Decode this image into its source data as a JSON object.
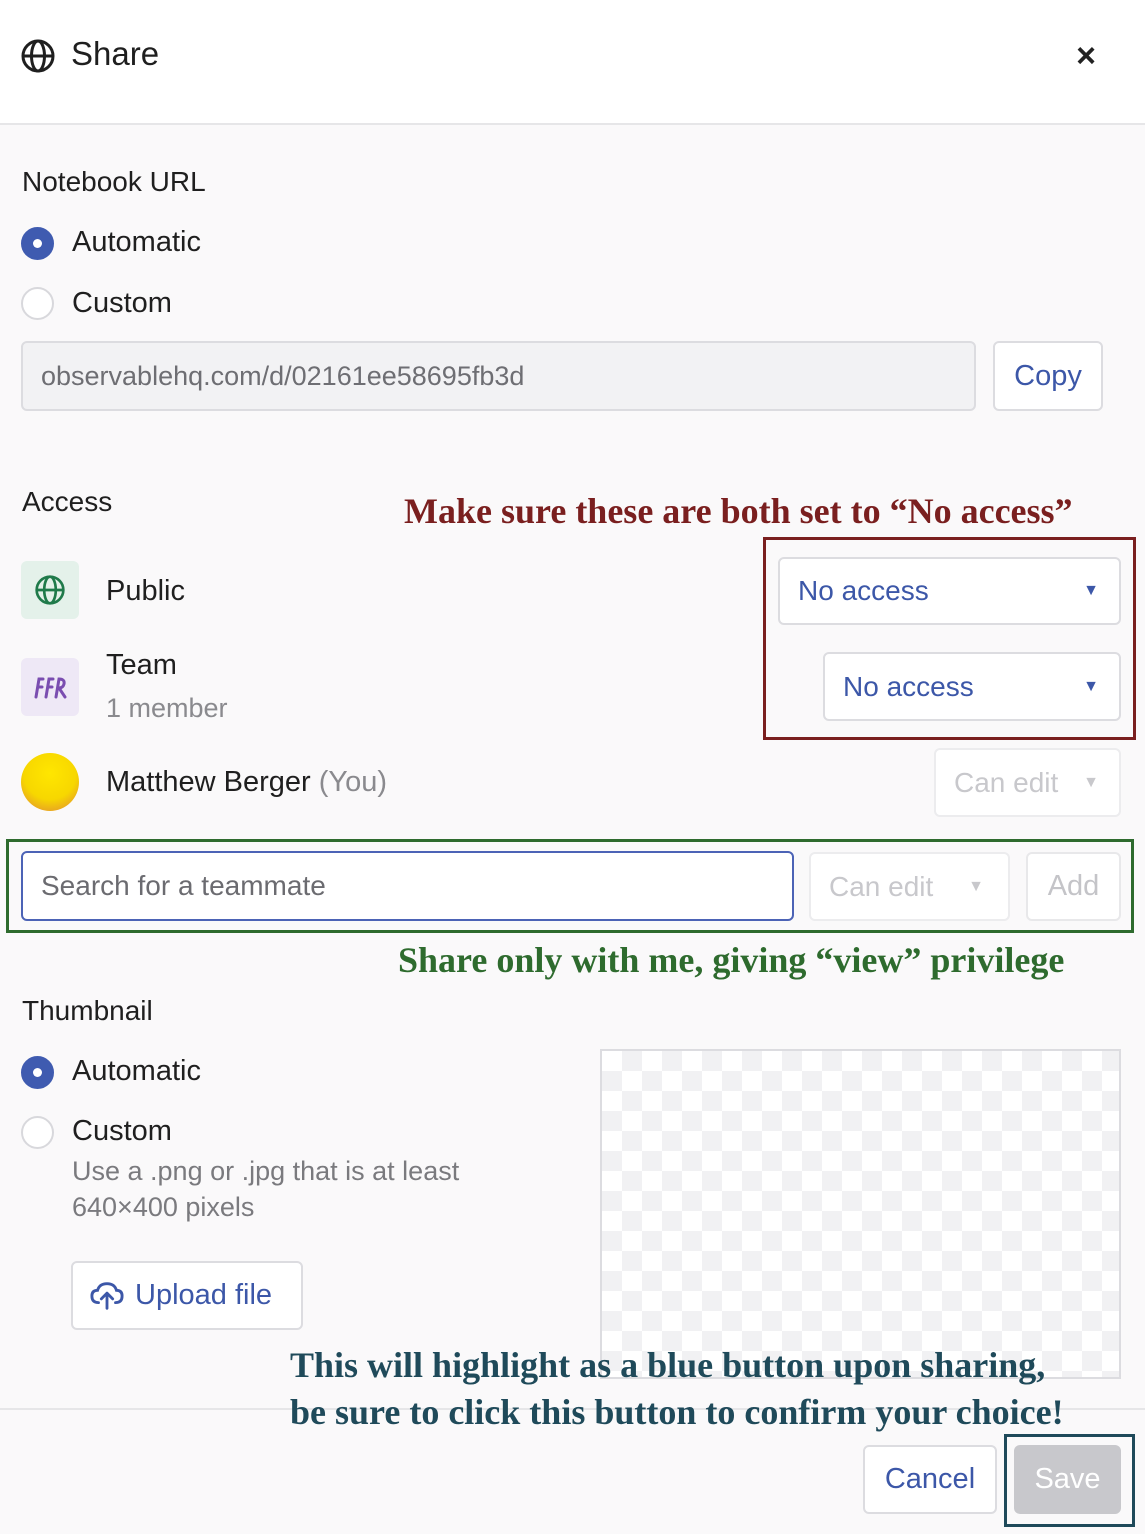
{
  "header": {
    "title": "Share",
    "title_icon": "globe-icon",
    "close_label": "×"
  },
  "notebook_url": {
    "label": "Notebook URL",
    "options": [
      "Automatic",
      "Custom"
    ],
    "selected": "Automatic",
    "url_value": "observablehq.com/d/02161ee58695fb3d",
    "copy_label": "Copy"
  },
  "access": {
    "label": "Access",
    "rows": [
      {
        "name": "Public",
        "icon": "globe-icon",
        "permission": "No access"
      },
      {
        "name": "Team",
        "sub": "1 member",
        "icon": "team-icon",
        "permission": "No access"
      },
      {
        "name": "Matthew Berger",
        "suffix": "(You)",
        "icon": "avatar",
        "permission": "Can edit"
      }
    ],
    "search_placeholder": "Search for a teammate",
    "search_permission": "Can edit",
    "add_label": "Add"
  },
  "thumbnail": {
    "label": "Thumbnail",
    "options": [
      "Automatic",
      "Custom"
    ],
    "selected": "Automatic",
    "hint_line1": "Use a .png or .jpg that is at least",
    "hint_line2": "640×400 pixels",
    "upload_label": "Upload file"
  },
  "footer": {
    "cancel_label": "Cancel",
    "save_label": "Save"
  },
  "annotations": {
    "access_note": "Make sure these are both set to “No access”",
    "share_note": "Share only with me, giving “view” privilege",
    "save_note_line1": "This will highlight as a blue button upon sharing,",
    "save_note_line2": "be sure to click this button to confirm your choice!"
  },
  "colors": {
    "accent": "#3f5bb0",
    "annotation_red": "#7a1f1f",
    "annotation_green": "#2e6b2e",
    "annotation_teal": "#1f4a5a"
  }
}
